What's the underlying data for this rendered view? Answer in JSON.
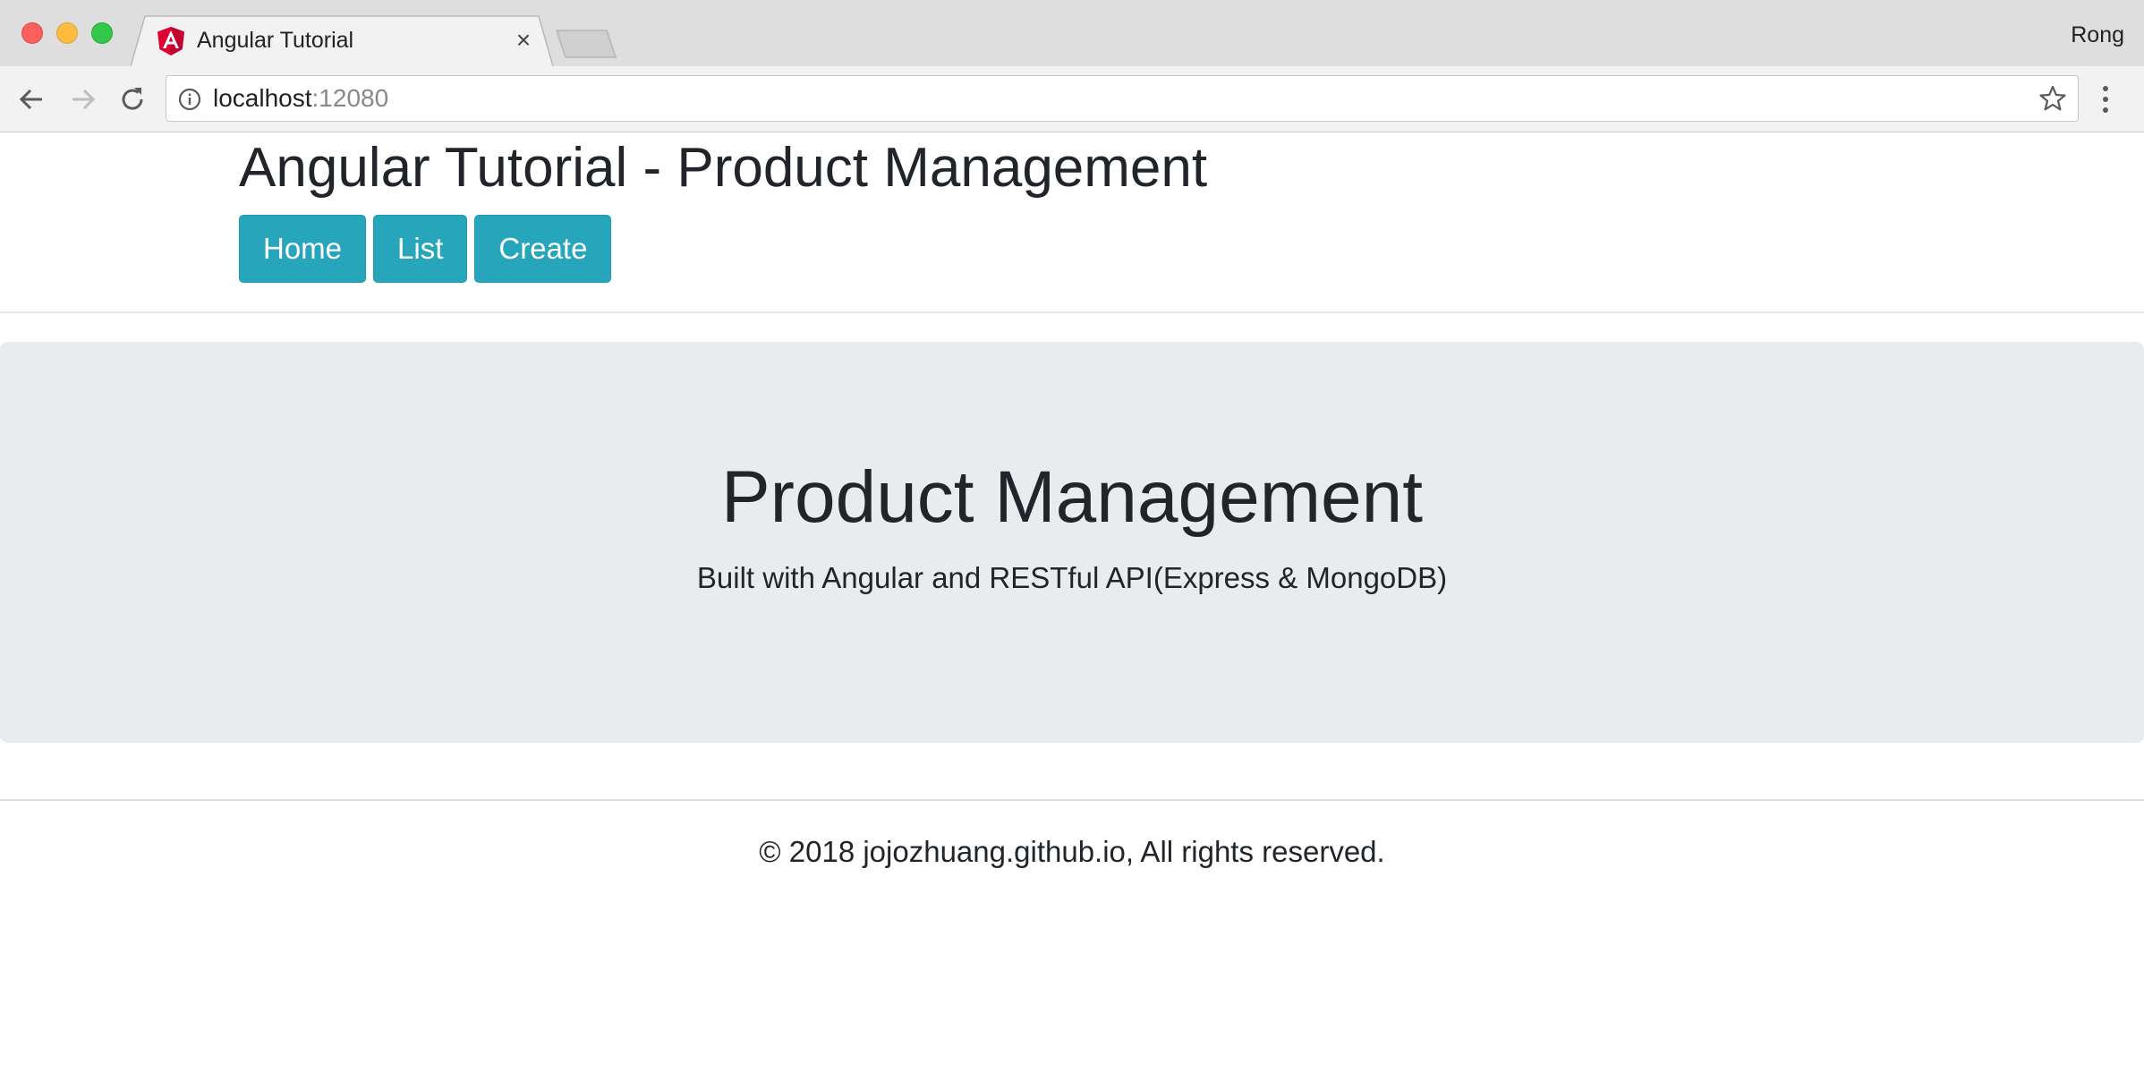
{
  "browser": {
    "tab": {
      "title": "Angular Tutorial",
      "close_glyph": "×",
      "favicon": "angular-logo-icon"
    },
    "profile_name": "Rong",
    "address_bar": {
      "host": "localhost",
      "port": ":12080"
    },
    "icons": {
      "back": "back-arrow-icon",
      "forward": "forward-arrow-icon",
      "reload": "reload-icon",
      "info": "info-icon",
      "bookmark": "star-icon",
      "menu": "kebab-menu-icon"
    }
  },
  "header": {
    "title": "Angular Tutorial - Product Management",
    "nav": [
      {
        "label": "Home"
      },
      {
        "label": "List"
      },
      {
        "label": "Create"
      }
    ]
  },
  "jumbotron": {
    "title": "Product Management",
    "subtitle": "Built with Angular and RESTful API(Express & MongoDB)"
  },
  "footer": {
    "text": "© 2018 jojozhuang.github.io, All rights reserved."
  },
  "colors": {
    "button": "#27a5ba",
    "jumbotron_bg": "#e9ecef",
    "text": "#212529",
    "angular_red": "#dd0031"
  }
}
